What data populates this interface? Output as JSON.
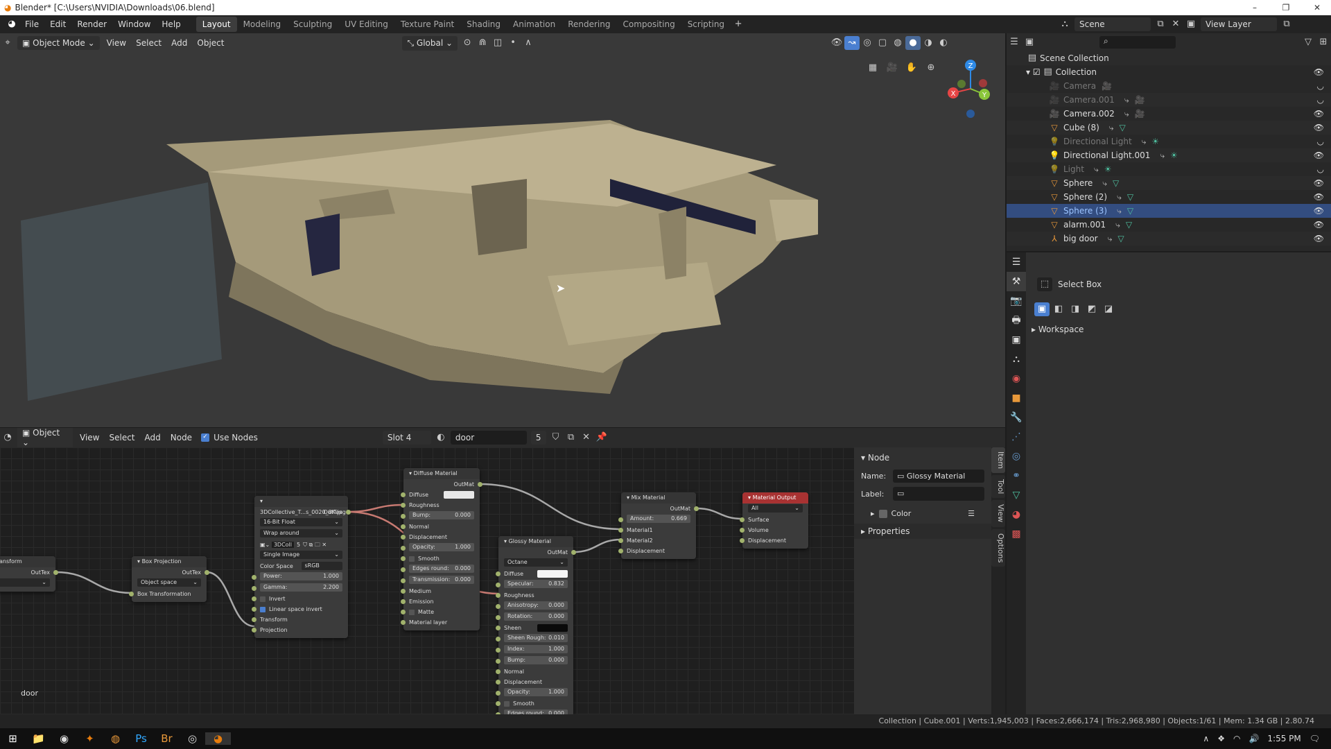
{
  "window": {
    "title": "Blender* [C:\\Users\\NVIDIA\\Downloads\\06.blend]"
  },
  "menus": [
    "File",
    "Edit",
    "Render",
    "Window",
    "Help"
  ],
  "workspaces": [
    {
      "label": "Layout",
      "active": true
    },
    {
      "label": "Modeling"
    },
    {
      "label": "Sculpting"
    },
    {
      "label": "UV Editing"
    },
    {
      "label": "Texture Paint"
    },
    {
      "label": "Shading"
    },
    {
      "label": "Animation"
    },
    {
      "label": "Rendering"
    },
    {
      "label": "Compositing"
    },
    {
      "label": "Scripting"
    }
  ],
  "scene": {
    "scene_name": "Scene",
    "view_layer": "View Layer"
  },
  "viewport": {
    "mode": "Object Mode",
    "menus": [
      "View",
      "Select",
      "Add",
      "Object"
    ],
    "transform_orientation": "Global",
    "gizmo": {
      "x": "X",
      "y": "Y",
      "z": "Z"
    }
  },
  "outliner": {
    "root": "Scene Collection",
    "collection": "Collection",
    "items": [
      {
        "name": "Camera",
        "type": "camera",
        "visible": false,
        "dim": true
      },
      {
        "name": "Camera.001",
        "type": "camera",
        "visible": false,
        "dim": true
      },
      {
        "name": "Camera.002",
        "type": "camera",
        "visible": true
      },
      {
        "name": "Cube (8)",
        "type": "mesh",
        "visible": true
      },
      {
        "name": "Directional Light",
        "type": "light",
        "visible": false,
        "dim": true
      },
      {
        "name": "Directional Light.001",
        "type": "light",
        "visible": true
      },
      {
        "name": "Light",
        "type": "light",
        "visible": false,
        "dim": true
      },
      {
        "name": "Sphere",
        "type": "mesh",
        "visible": true
      },
      {
        "name": "Sphere (2)",
        "type": "mesh",
        "visible": true
      },
      {
        "name": "Sphere (3)",
        "type": "mesh",
        "visible": true,
        "selected": true
      },
      {
        "name": "alarm.001",
        "type": "mesh",
        "visible": true
      },
      {
        "name": "big door",
        "type": "empty",
        "visible": true
      }
    ]
  },
  "properties": {
    "tool": "Select Box",
    "workspace": "Workspace"
  },
  "node_editor": {
    "type": "Object",
    "menus": [
      "View",
      "Select",
      "Add",
      "Node"
    ],
    "use_nodes_label": "Use Nodes",
    "use_nodes": true,
    "slot": "Slot 4",
    "material": "door",
    "users": "5",
    "material_label": "door",
    "sidebar": {
      "section": "Node",
      "name_label": "Name:",
      "name_value": "Glossy Material",
      "label_label": "Label:",
      "label_value": "",
      "color": "Color",
      "properties": "Properties",
      "tabs": [
        "Item",
        "Tool",
        "View",
        "Options"
      ]
    }
  },
  "nodes": [
    {
      "id": "tex-transform",
      "title": "e Transform",
      "rows": [
        {
          "k": "out",
          "t": "OutTex"
        },
        {
          "k": "drop",
          "t": ""
        }
      ]
    },
    {
      "id": "box-projection",
      "title": "Box Projection",
      "rows": [
        {
          "k": "out",
          "t": "OutTex"
        },
        {
          "k": "drop",
          "t": "Object space"
        },
        {
          "k": "in",
          "t": "Box Transformation"
        }
      ]
    },
    {
      "id": "image-texture",
      "title": "3DCollective_T...s_0020_8K.jpg",
      "rows": [
        {
          "k": "out",
          "t": "OutTex"
        },
        {
          "k": "drop",
          "t": "16-Bit Float"
        },
        {
          "k": "drop",
          "t": "Wrap around"
        },
        {
          "k": "img",
          "t": "3DColl",
          "n": "5"
        },
        {
          "k": "drop",
          "t": "Single Image"
        },
        {
          "k": "drop2",
          "l": "Color Space",
          "t": "sRGB"
        },
        {
          "k": "fld",
          "l": "Power:",
          "v": "1.000"
        },
        {
          "k": "fld",
          "l": "Gamma:",
          "v": "2.200"
        },
        {
          "k": "cb",
          "t": "Invert",
          "on": false
        },
        {
          "k": "cb",
          "t": "Linear space invert",
          "on": true
        },
        {
          "k": "in",
          "t": "Transform"
        },
        {
          "k": "in",
          "t": "Projection"
        }
      ]
    },
    {
      "id": "diffuse-material",
      "title": "Diffuse Material",
      "rows": [
        {
          "k": "out",
          "t": "OutMat"
        },
        {
          "k": "color",
          "t": "Diffuse",
          "c": "#e8e8e8"
        },
        {
          "k": "in",
          "t": "Roughness"
        },
        {
          "k": "fld",
          "l": "Bump:",
          "v": "0.000"
        },
        {
          "k": "in",
          "t": "Normal"
        },
        {
          "k": "in",
          "t": "Displacement"
        },
        {
          "k": "fld",
          "l": "Opacity:",
          "v": "1.000"
        },
        {
          "k": "cb",
          "t": "Smooth",
          "on": false
        },
        {
          "k": "fld",
          "l": "Edges round:",
          "v": "0.000"
        },
        {
          "k": "fld",
          "l": "Transmission:",
          "v": "0.000"
        },
        {
          "k": "in",
          "t": "Medium"
        },
        {
          "k": "in",
          "t": "Emission"
        },
        {
          "k": "cb",
          "t": "Matte",
          "on": false
        },
        {
          "k": "in",
          "t": "Material layer"
        }
      ]
    },
    {
      "id": "glossy-material",
      "title": "Glossy Material",
      "rows": [
        {
          "k": "out",
          "t": "OutMat"
        },
        {
          "k": "drop",
          "t": "Octane"
        },
        {
          "k": "color",
          "t": "Diffuse",
          "c": "#f4f4f4"
        },
        {
          "k": "fld",
          "l": "Specular:",
          "v": "0.832"
        },
        {
          "k": "in",
          "t": "Roughness"
        },
        {
          "k": "fld",
          "l": "Anisotropy:",
          "v": "0.000"
        },
        {
          "k": "fld",
          "l": "Rotation:",
          "v": "0.000"
        },
        {
          "k": "color",
          "t": "Sheen",
          "c": "#0a0a0a"
        },
        {
          "k": "fld",
          "l": "Sheen Rough:",
          "v": "0.010"
        },
        {
          "k": "fld",
          "l": "Index:",
          "v": "1.000"
        },
        {
          "k": "fld",
          "l": "Bump:",
          "v": "0.000"
        },
        {
          "k": "in",
          "t": "Normal"
        },
        {
          "k": "in",
          "t": "Displacement"
        },
        {
          "k": "fld",
          "l": "Opacity:",
          "v": "1.000"
        },
        {
          "k": "cb",
          "t": "Smooth",
          "on": false
        },
        {
          "k": "fld",
          "l": "Edges round:",
          "v": "0.000"
        }
      ]
    },
    {
      "id": "mix-material",
      "title": "Mix Material",
      "rows": [
        {
          "k": "out",
          "t": "OutMat"
        },
        {
          "k": "fld",
          "l": "Amount:",
          "v": "0.669"
        },
        {
          "k": "in",
          "t": "Material1"
        },
        {
          "k": "in",
          "t": "Material2"
        },
        {
          "k": "in",
          "t": "Displacement"
        }
      ]
    },
    {
      "id": "material-output",
      "title": "Material Output",
      "rows": [
        {
          "k": "drop",
          "t": "All"
        },
        {
          "k": "in",
          "t": "Surface"
        },
        {
          "k": "in",
          "t": "Volume"
        },
        {
          "k": "in",
          "t": "Displacement"
        }
      ]
    }
  ],
  "status": {
    "text": "Collection | Cube.001 | Verts:1,945,003 | Faces:2,666,174 | Tris:2,968,980 | Objects:1/61 | Mem: 1.34 GB | 2.80.74"
  },
  "taskbar": {
    "time": "1:55 PM"
  },
  "colors": {
    "accent": "#4a7fd0",
    "selection": "#334d80",
    "output_header": "#a83232",
    "object_icon": "#e8983a",
    "data_icon": "#4fc0a0"
  }
}
